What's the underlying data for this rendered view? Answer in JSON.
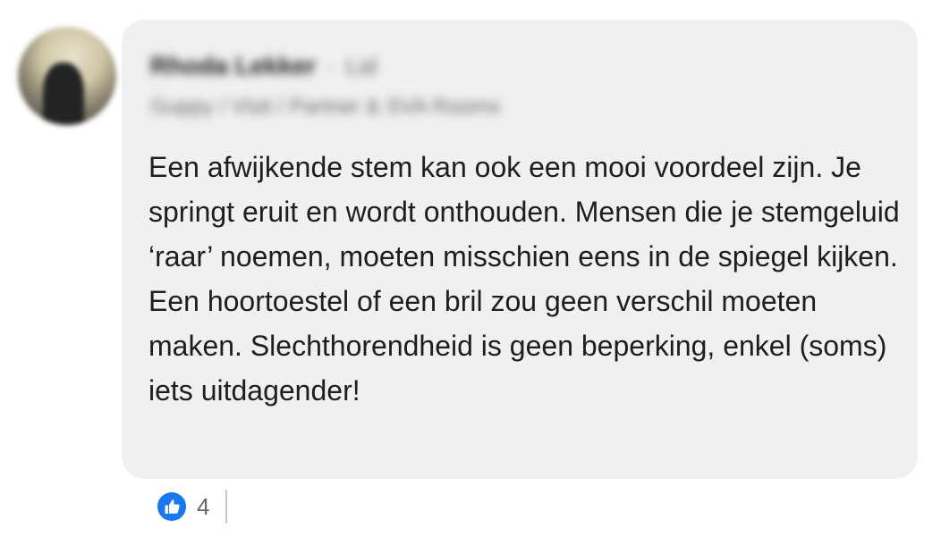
{
  "comment": {
    "author_name": "Rhoda Lekker",
    "author_status": "Lid",
    "author_subtitle": "Guppy / Visit / Partner & SVA Rooms",
    "text": "Een afwijkende stem kan ook een mooi voordeel zijn. Je springt eruit en wordt onthouden. Mensen die je stemgeluid ‘raar’ noemen, moeten misschien eens in de spiegel kijken. Een hoortoestel of een bril zou geen verschil moeten maken. Slechthorendheid is geen beperking, enkel (soms) iets uitdagender!"
  },
  "reactions": {
    "like_icon": "thumbs-up-icon",
    "count": "4"
  },
  "colors": {
    "bubble_background": "#f0f0f0",
    "like_blue": "#1877f2"
  }
}
